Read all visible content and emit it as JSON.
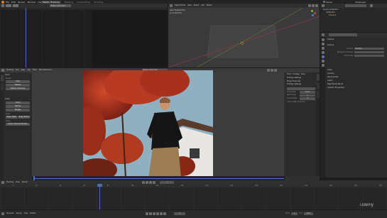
{
  "top_bar": {
    "menus": [
      "File",
      "Edit",
      "Render",
      "Window",
      "Help"
    ],
    "workspace_tabs": [
      "Motion Tracking",
      "Masking",
      "Compositing",
      "Scripting"
    ],
    "active_tab": "Motion Tracking",
    "scene_name": "Scene",
    "view_layer": "ViewLayer"
  },
  "tl_header": {
    "movie_name": "HOW2-1234.mp4"
  },
  "tr_header": {
    "mode": "Object Mode",
    "menus": [
      "View",
      "Select",
      "Add",
      "Object"
    ]
  },
  "tr_overlay": {
    "line1": "User Perspective",
    "line2": "(1) Collection"
  },
  "outliner": {
    "items": [
      "Scene Collection",
      "Collection",
      "Camera"
    ]
  },
  "properties": {
    "header": "Scene",
    "section_scene": "Scene",
    "fields": [
      {
        "label": "Camera",
        "value": "Camera"
      },
      {
        "label": "Background Scene",
        "value": ""
      },
      {
        "label": "Active Clip",
        "value": ""
      }
    ],
    "sections": [
      "Units",
      "Gravity",
      "Keying Sets",
      "Audio",
      "Rigid Body World",
      "Custom Properties"
    ]
  },
  "clip_header": {
    "mode": "Tracking",
    "view": "Clip",
    "menus": [
      "View",
      "Clip",
      "Track",
      "Reconstruction"
    ],
    "movie_name": "HOW2-1234.mp4"
  },
  "tool_panel": {
    "title_track": "Track",
    "section_marker": "Marker",
    "marker_buttons": [
      "Add",
      "Delete",
      "Detect Features"
    ],
    "section_tracking": "Track",
    "track_buttons": [
      "Track",
      "Refine",
      "Merge"
    ],
    "section_clear": "Clear",
    "clear_buttons": [
      "Clear After",
      "Clear Before"
    ],
    "section_solve": "Solve",
    "solve_buttons": [
      "Solve Camera Motion"
    ]
  },
  "track_panel": {
    "tabs": [
      "Track",
      "Footage",
      "View"
    ],
    "sections": [
      "Footage Settings",
      "Proxy/Timecode",
      "Footage Settings"
    ],
    "rows": [
      {
        "label": "Frame Rate",
        "value": "24.00"
      },
      {
        "label": "Start Frame",
        "value": "1"
      },
      {
        "label": "Frame Offset",
        "value": "0"
      }
    ],
    "info": "1920 x 1080, 24.00 fps"
  },
  "clip_timeline": {
    "frame_numbers": [
      "0",
      "20",
      "40",
      "60",
      "80",
      "100",
      "120",
      "140",
      "160",
      "180",
      "200",
      "220",
      "240",
      "260",
      "280",
      "300"
    ]
  },
  "bottom_header": {
    "mode": "Tracking",
    "menus": [
      "View",
      "Marker"
    ],
    "current_frame": "1"
  },
  "timeline": {
    "header": [
      "Playback",
      "Keying",
      "View",
      "Marker"
    ],
    "start_label": "Start",
    "start": "1",
    "end_label": "End",
    "end": "300",
    "current_frame": "1",
    "frames": [
      "0",
      "20",
      "40",
      "60",
      "80",
      "100",
      "120",
      "140",
      "160",
      "180",
      "200",
      "220",
      "240",
      "260",
      "280",
      "300"
    ]
  },
  "watermark": "Udemy"
}
